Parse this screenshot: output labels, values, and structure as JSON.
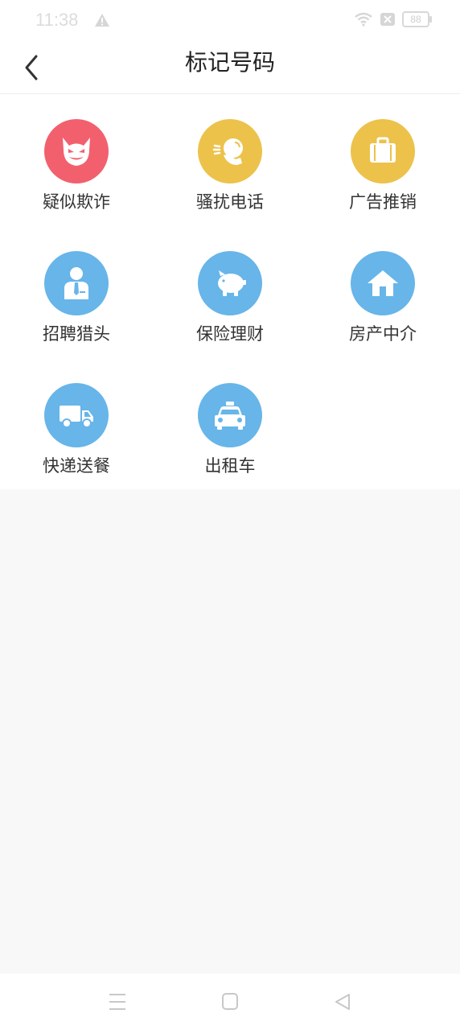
{
  "status_bar": {
    "time": "11:38",
    "battery": "88"
  },
  "header": {
    "title": "标记号码",
    "back_icon": "chevron-left-icon"
  },
  "categories": [
    {
      "label": "疑似欺诈",
      "icon": "devil-face-icon",
      "color": "#f2606e"
    },
    {
      "label": "骚扰电话",
      "icon": "phone-talk-icon",
      "color": "#ecc24b"
    },
    {
      "label": "广告推销",
      "icon": "briefcase-icon",
      "color": "#ecc24b"
    },
    {
      "label": "招聘猎头",
      "icon": "businessman-icon",
      "color": "#67b5e9"
    },
    {
      "label": "保险理财",
      "icon": "piggy-bank-icon",
      "color": "#67b5e9"
    },
    {
      "label": "房产中介",
      "icon": "house-icon",
      "color": "#67b5e9"
    },
    {
      "label": "快递送餐",
      "icon": "truck-icon",
      "color": "#67b5e9"
    },
    {
      "label": "出租车",
      "icon": "taxi-icon",
      "color": "#67b5e9"
    }
  ],
  "system_nav": {
    "menu_icon": "menu-icon",
    "home_icon": "home-square-icon",
    "back_icon": "back-triangle-icon"
  }
}
